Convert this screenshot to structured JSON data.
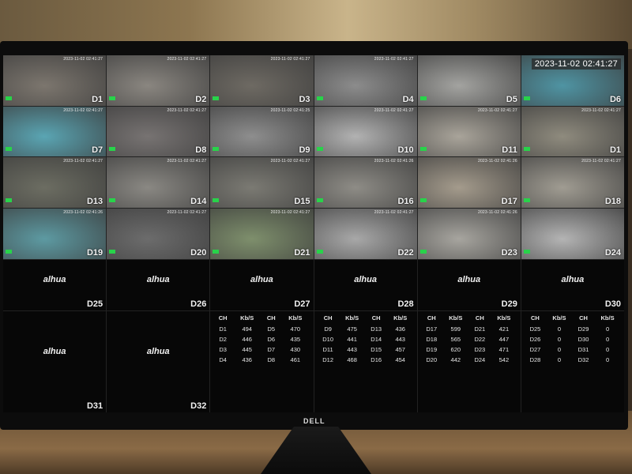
{
  "brand": {
    "monitor_logo": "DELL",
    "dvr_logo": "alhua"
  },
  "cameras": [
    {
      "label": "D1",
      "timestamp": "2023-11-02 02:41:27",
      "tone": "#7c766e"
    },
    {
      "label": "D2",
      "timestamp": "2023-11-02 02:41:27",
      "tone": "#8a8680"
    },
    {
      "label": "D3",
      "timestamp": "2023-11-02 02:41:27",
      "tone": "#6e6a63"
    },
    {
      "label": "D4",
      "timestamp": "2023-11-02 02:41:27",
      "tone": "#8c8c8c"
    },
    {
      "label": "D5",
      "timestamp": "",
      "tone": "#a3a3a0"
    },
    {
      "label": "D6",
      "timestamp": "2023-11-02 02:41:27",
      "tone": "#4f94a3"
    },
    {
      "label": "D7",
      "timestamp": "2023-11-02 02:41:27",
      "tone": "#5aa5b3"
    },
    {
      "label": "D8",
      "timestamp": "2023-11-02 02:41:27",
      "tone": "#777372"
    },
    {
      "label": "D9",
      "timestamp": "2023-11-02 02:41:25",
      "tone": "#8e8e8e"
    },
    {
      "label": "D10",
      "timestamp": "2023-11-02 02:41:27",
      "tone": "#b2b2b2"
    },
    {
      "label": "D11",
      "timestamp": "2023-11-02 02:41:27",
      "tone": "#a9a49a"
    },
    {
      "label": "D1",
      "timestamp": "2023-11-02 02:41:27",
      "tone": "#8f8b7e"
    },
    {
      "label": "D13",
      "timestamp": "2023-11-02 02:41:27",
      "tone": "#6c6d62"
    },
    {
      "label": "D14",
      "timestamp": "2023-11-02 02:41:27",
      "tone": "#8a8883"
    },
    {
      "label": "D15",
      "timestamp": "2023-11-02 02:41:27",
      "tone": "#7b7a73"
    },
    {
      "label": "D16",
      "timestamp": "2023-11-02 02:41:26",
      "tone": "#8e8c86"
    },
    {
      "label": "D17",
      "timestamp": "2023-11-02 02:41:26",
      "tone": "#a49b8c"
    },
    {
      "label": "D18",
      "timestamp": "2023-11-02 02:41:27",
      "tone": "#a09c92"
    },
    {
      "label": "D19",
      "timestamp": "2023-11-02 02:41:26",
      "tone": "#5d9aa2"
    },
    {
      "label": "D20",
      "timestamp": "2023-11-02 02:41:27",
      "tone": "#6c6c6c"
    },
    {
      "label": "D21",
      "timestamp": "2023-11-02 02:41:27",
      "tone": "#7e8f6c"
    },
    {
      "label": "D22",
      "timestamp": "2023-11-02 02:41:27",
      "tone": "#a8a8a8"
    },
    {
      "label": "D23",
      "timestamp": "2023-11-02 02:41:26",
      "tone": "#a7a59f"
    },
    {
      "label": "D24",
      "timestamp": "",
      "tone": "#b4b4b4"
    }
  ],
  "big_timestamp": "2023-11-02 02:41:27",
  "offline": [
    {
      "label": "D25"
    },
    {
      "label": "D26"
    },
    {
      "label": "D27"
    },
    {
      "label": "D28"
    },
    {
      "label": "D29"
    },
    {
      "label": "D30"
    },
    {
      "label": "D31"
    },
    {
      "label": "D32"
    }
  ],
  "bitrate_panels": [
    {
      "headers": [
        "CH",
        "Kb/S",
        "CH",
        "Kb/S"
      ],
      "rows": [
        [
          "D1",
          "494",
          "D5",
          "470"
        ],
        [
          "D2",
          "446",
          "D6",
          "435"
        ],
        [
          "D3",
          "445",
          "D7",
          "430"
        ],
        [
          "D4",
          "436",
          "D8",
          "461"
        ]
      ]
    },
    {
      "headers": [
        "CH",
        "Kb/S",
        "CH",
        "Kb/S"
      ],
      "rows": [
        [
          "D9",
          "475",
          "D13",
          "436"
        ],
        [
          "D10",
          "441",
          "D14",
          "443"
        ],
        [
          "D11",
          "443",
          "D15",
          "457"
        ],
        [
          "D12",
          "468",
          "D16",
          "454"
        ]
      ]
    },
    {
      "headers": [
        "CH",
        "Kb/S",
        "CH",
        "Kb/S"
      ],
      "rows": [
        [
          "D17",
          "599",
          "D21",
          "421"
        ],
        [
          "D18",
          "565",
          "D22",
          "447"
        ],
        [
          "D19",
          "620",
          "D23",
          "471"
        ],
        [
          "D20",
          "442",
          "D24",
          "542"
        ]
      ]
    },
    {
      "headers": [
        "CH",
        "Kb/S",
        "CH",
        "Kb/S"
      ],
      "rows": [
        [
          "D25",
          "0",
          "D29",
          "0"
        ],
        [
          "D26",
          "0",
          "D30",
          "0"
        ],
        [
          "D27",
          "0",
          "D31",
          "0"
        ],
        [
          "D28",
          "0",
          "D32",
          "0"
        ]
      ]
    }
  ],
  "colors": {
    "selected_outline": "#3fe36b",
    "record_indicator": "#28d34a",
    "alarm_bell": "#e23b3b"
  }
}
